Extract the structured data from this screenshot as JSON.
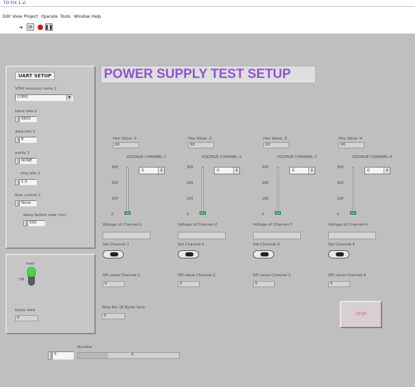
{
  "window": {
    "title": "TO FIX 1.vi"
  },
  "menu": [
    "Edit",
    "View",
    "Project",
    "Operate",
    "Tools",
    "Window",
    "Help"
  ],
  "toolbar": {
    "icons": [
      "run-arrow-icon",
      "run-continuous-icon",
      "abort-stop-icon",
      "pause-icon"
    ]
  },
  "main_title": "POWER SUPPLY TEST SETUP",
  "uart": {
    "title": "UART SETUP",
    "visa_label": "VISA resource name 2",
    "visa_value": "COM1",
    "baud_label": "baud rate 2",
    "baud_value": "9600",
    "data_bits_label": "data bits 2",
    "data_bits_value": "8",
    "parity_label": "parity 2",
    "parity_value": "NONE",
    "stop_bits_label": "stop bits 2",
    "stop_bits_value": "1.0",
    "flow_label": "flow control 2",
    "flow_value": "None",
    "delay_label": "delay before read (ms)",
    "delay_value": "500"
  },
  "read": {
    "read_label": "read",
    "state": "ON",
    "led_color": "#3fd94a",
    "bytes_label": "bytes read",
    "bytes_value": "0"
  },
  "channels": [
    {
      "hex_label": "Hex Value -1",
      "hex_value": "00",
      "vc_label": "VOLTAGE CHANNEL-1",
      "vc_value": "0",
      "volt_label": "Voltage of Channel-1",
      "set_label": "Set Channel-1",
      "spi_label": "SPI value Channel-1",
      "spi_value": "0",
      "slider_value": 0
    },
    {
      "hex_label": "Hex Value -2",
      "hex_value": "00",
      "vc_label": "VOLTAGE CHANNEL-2",
      "vc_value": "0",
      "volt_label": "Voltage of Channel-2",
      "set_label": "Set Channel-2",
      "spi_label": "SPI value Channel-2",
      "spi_value": "0",
      "slider_value": 0
    },
    {
      "hex_label": "Hex Value -3",
      "hex_value": "00",
      "vc_label": "VOLTAGE CHANNEL-3",
      "vc_value": "0",
      "volt_label": "Voltage of Channel-3",
      "set_label": "Set Channel-3",
      "spi_label": "SPI value Channel-3",
      "spi_value": "0",
      "slider_value": 0
    },
    {
      "hex_label": "Hex Value -4",
      "hex_value": "00",
      "vc_label": "VOLTAGE CHANNEL-4",
      "vc_value": "0",
      "volt_label": "Voltage of Channel-4",
      "set_label": "Set Channel-4",
      "spi_label": "SPI value Channel-4",
      "spi_value": "0",
      "slider_value": 0
    }
  ],
  "slider_ticks": [
    "300",
    "200",
    "100",
    "0"
  ],
  "total": {
    "label": "Total No. Of Bytes Sent",
    "value": "0"
  },
  "stop": {
    "label": "STOP"
  },
  "number": {
    "label": "Number",
    "value": "0",
    "index_value": "0",
    "progress_fraction": 0.3
  }
}
